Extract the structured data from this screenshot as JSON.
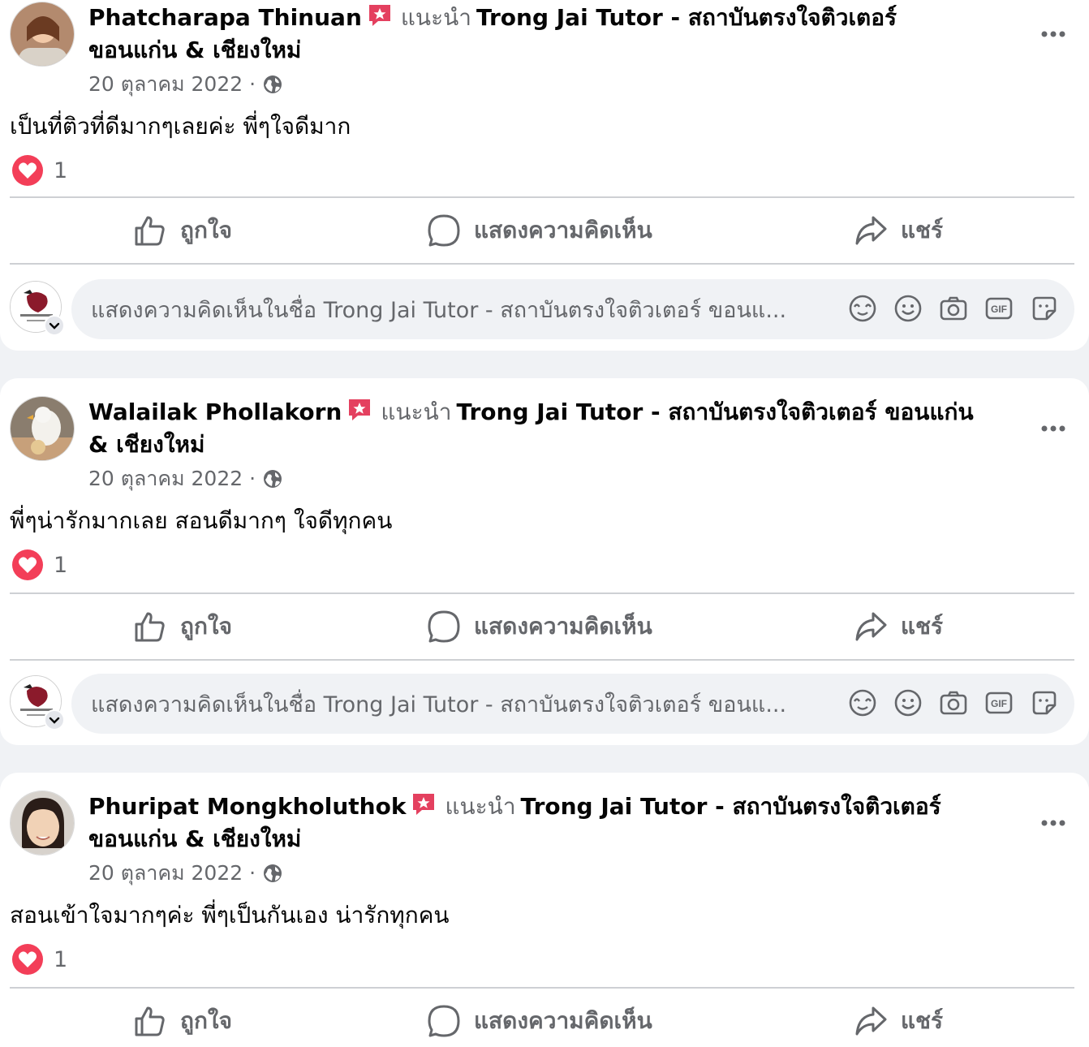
{
  "posts": [
    {
      "author": "Phatcharapa Thinuan",
      "recommends": "แนะนำ",
      "page": "Trong Jai Tutor - สถาบันตรงใจติวเตอร์ ขอนแก่น & เชียงใหม่",
      "date": "20 ตุลาคม 2022",
      "separator": "·",
      "text": "เป็นที่ติวที่ดีมากๆเลยค่ะ พี่ๆใจดีมาก",
      "reaction_count": "1"
    },
    {
      "author": "Walailak Phollakorn",
      "recommends": "แนะนำ",
      "page": "Trong Jai Tutor - สถาบันตรงใจติวเตอร์ ขอนแก่น & เชียงใหม่",
      "date": "20 ตุลาคม 2022",
      "separator": "·",
      "text": "พี่ๆน่ารักมากเลย สอนดีมากๆ ใจดีทุกคน",
      "reaction_count": "1"
    },
    {
      "author": "Phuripat Mongkholuthok",
      "recommends": "แนะนำ",
      "page": "Trong Jai Tutor - สถาบันตรงใจติวเตอร์ ขอนแก่น & เชียงใหม่",
      "date": "20 ตุลาคม 2022",
      "separator": "·",
      "text": "สอนเข้าใจมากๆค่ะ พี่ๆเป็นกันเอง น่ารักทุกคน",
      "reaction_count": "1"
    }
  ],
  "actions": {
    "like": "ถูกใจ",
    "comment": "แสดงความคิดเห็น",
    "share": "แชร์"
  },
  "composer": {
    "placeholder": "แสดงความคิดเห็นในชื่อ Trong Jai Tutor - สถาบันตรงใจติวเตอร์ ขอนแ..."
  },
  "colors": {
    "background": "#f0f2f5",
    "card": "#ffffff",
    "secondary_text": "#65676b",
    "badge": "#e4405f",
    "love": "#f33e58",
    "divider": "#ced0d4"
  },
  "icons": [
    "recommend-badge-icon",
    "globe-icon",
    "more-icon",
    "love-reaction-icon",
    "like-icon",
    "comment-icon",
    "share-icon",
    "avatar-icon",
    "emoji-icon",
    "camera-icon",
    "gif-icon",
    "sticker-icon"
  ]
}
